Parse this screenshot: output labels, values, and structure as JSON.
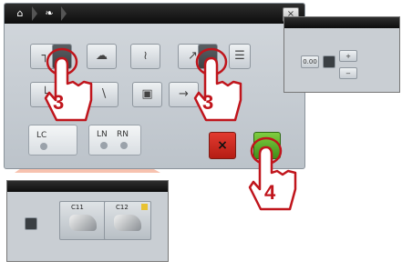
{
  "toolbar": {
    "crumbs": [
      "⌂",
      "❧"
    ],
    "close_label": "×"
  },
  "grid": {
    "row1": [
      "┐",
      "☁",
      "≀",
      "↗",
      "☰"
    ],
    "row2": [
      "└",
      "∖",
      "▣",
      "→"
    ]
  },
  "toggles": {
    "lc_label": "LC",
    "ln_label": "LN",
    "rn_label": "RN"
  },
  "actions": {
    "cancel_label": "×"
  },
  "callout_right": {
    "value": "0.00",
    "plus": "+",
    "minus": "−"
  },
  "callout_bottom": {
    "feet": [
      "C11",
      "C12"
    ]
  },
  "steps": {
    "step_a": "3",
    "step_b": "3",
    "step_c": "4"
  },
  "colors": {
    "cancel": "#c9271d",
    "confirm": "#5aae2b",
    "step_number": "#c0151c",
    "beam": "#f3a88f"
  }
}
